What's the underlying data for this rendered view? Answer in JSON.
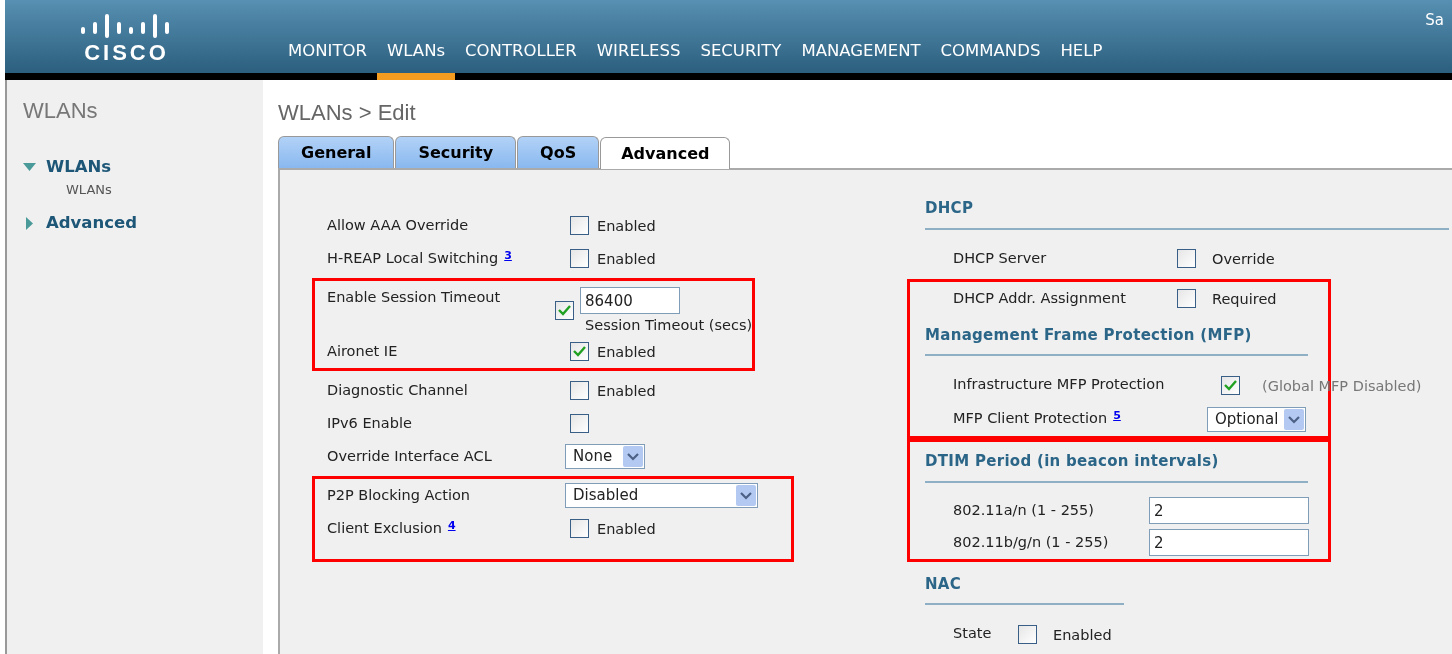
{
  "header": {
    "logo": "CISCO",
    "corner_text": "Sa",
    "menu": [
      {
        "label": "MONITOR",
        "selected": false
      },
      {
        "label": "WLANs",
        "selected": true
      },
      {
        "label": "CONTROLLER",
        "selected": false
      },
      {
        "label": "WIRELESS",
        "selected": false
      },
      {
        "label": "SECURITY",
        "selected": false
      },
      {
        "label": "MANAGEMENT",
        "selected": false
      },
      {
        "label": "COMMANDS",
        "selected": false
      },
      {
        "label": "HELP",
        "selected": false
      }
    ]
  },
  "sidebar": {
    "title": "WLANs",
    "items": [
      {
        "label": "WLANs",
        "expanded": true,
        "children": [
          {
            "label": "WLANs"
          }
        ]
      },
      {
        "label": "Advanced",
        "expanded": false
      }
    ]
  },
  "page_title": "WLANs > Edit",
  "tabs": [
    {
      "label": "General",
      "selected": false
    },
    {
      "label": "Security",
      "selected": false
    },
    {
      "label": "QoS",
      "selected": false
    },
    {
      "label": "Advanced",
      "selected": true
    }
  ],
  "left_groups": [
    {
      "highlighted": false,
      "rows": [
        {
          "kind": "checkbox",
          "label": "Allow AAA Override",
          "checked": false,
          "option": "Enabled"
        },
        {
          "kind": "checkbox",
          "label": "H-REAP Local Switching",
          "footnote": "3",
          "checked": false,
          "option": "Enabled"
        }
      ]
    },
    {
      "highlighted": true,
      "rows": [
        {
          "kind": "checkbox_input",
          "label": "Enable Session Timeout",
          "checked": true,
          "value": "86400",
          "caption": "Session Timeout (secs)"
        },
        {
          "kind": "checkbox",
          "label": "Aironet IE",
          "checked": true,
          "option": "Enabled"
        }
      ]
    },
    {
      "highlighted": false,
      "rows": [
        {
          "kind": "checkbox",
          "label": "Diagnostic Channel",
          "checked": false,
          "option": "Enabled"
        },
        {
          "kind": "checkbox",
          "label": "IPv6 Enable",
          "checked": false
        },
        {
          "kind": "dropdown",
          "label": "Override Interface ACL",
          "value": "None"
        }
      ]
    },
    {
      "highlighted": true,
      "rows": [
        {
          "kind": "wide_dropdown",
          "label": "P2P Blocking Action",
          "value": "Disabled"
        },
        {
          "kind": "checkbox",
          "label": "Client Exclusion",
          "footnote": "4",
          "checked": false,
          "option": "Enabled"
        }
      ]
    }
  ],
  "right_groups": [
    {
      "highlighted": false,
      "items": [
        {
          "kind": "heading",
          "text": "DHCP"
        },
        {
          "kind": "checkbox",
          "label": "DHCP Server",
          "checked": false,
          "option": "Override"
        }
      ]
    },
    {
      "highlighted": true,
      "items": [
        {
          "kind": "checkbox",
          "label": "DHCP Addr. Assignment",
          "checked": false,
          "option": "Required"
        },
        {
          "kind": "heading",
          "text": "Management Frame Protection (MFP)"
        },
        {
          "kind": "checkbox",
          "label": "Infrastructure MFP Protection",
          "checked": true,
          "note": "(Global MFP Disabled)"
        },
        {
          "kind": "dropdown",
          "label": "MFP Client Protection",
          "footnote": "5",
          "value": "Optional"
        }
      ]
    },
    {
      "highlighted": true,
      "items": [
        {
          "kind": "heading",
          "text": "DTIM Period (in beacon intervals)"
        },
        {
          "kind": "input",
          "label": "802.11a/n (1 - 255)",
          "value": "2"
        },
        {
          "kind": "input",
          "label": "802.11b/g/n (1 - 255)",
          "value": "2"
        }
      ]
    },
    {
      "highlighted": false,
      "items": [
        {
          "kind": "heading",
          "text": "NAC"
        },
        {
          "kind": "checkbox",
          "label": "State",
          "checked": false,
          "option": "Enabled"
        }
      ]
    }
  ]
}
